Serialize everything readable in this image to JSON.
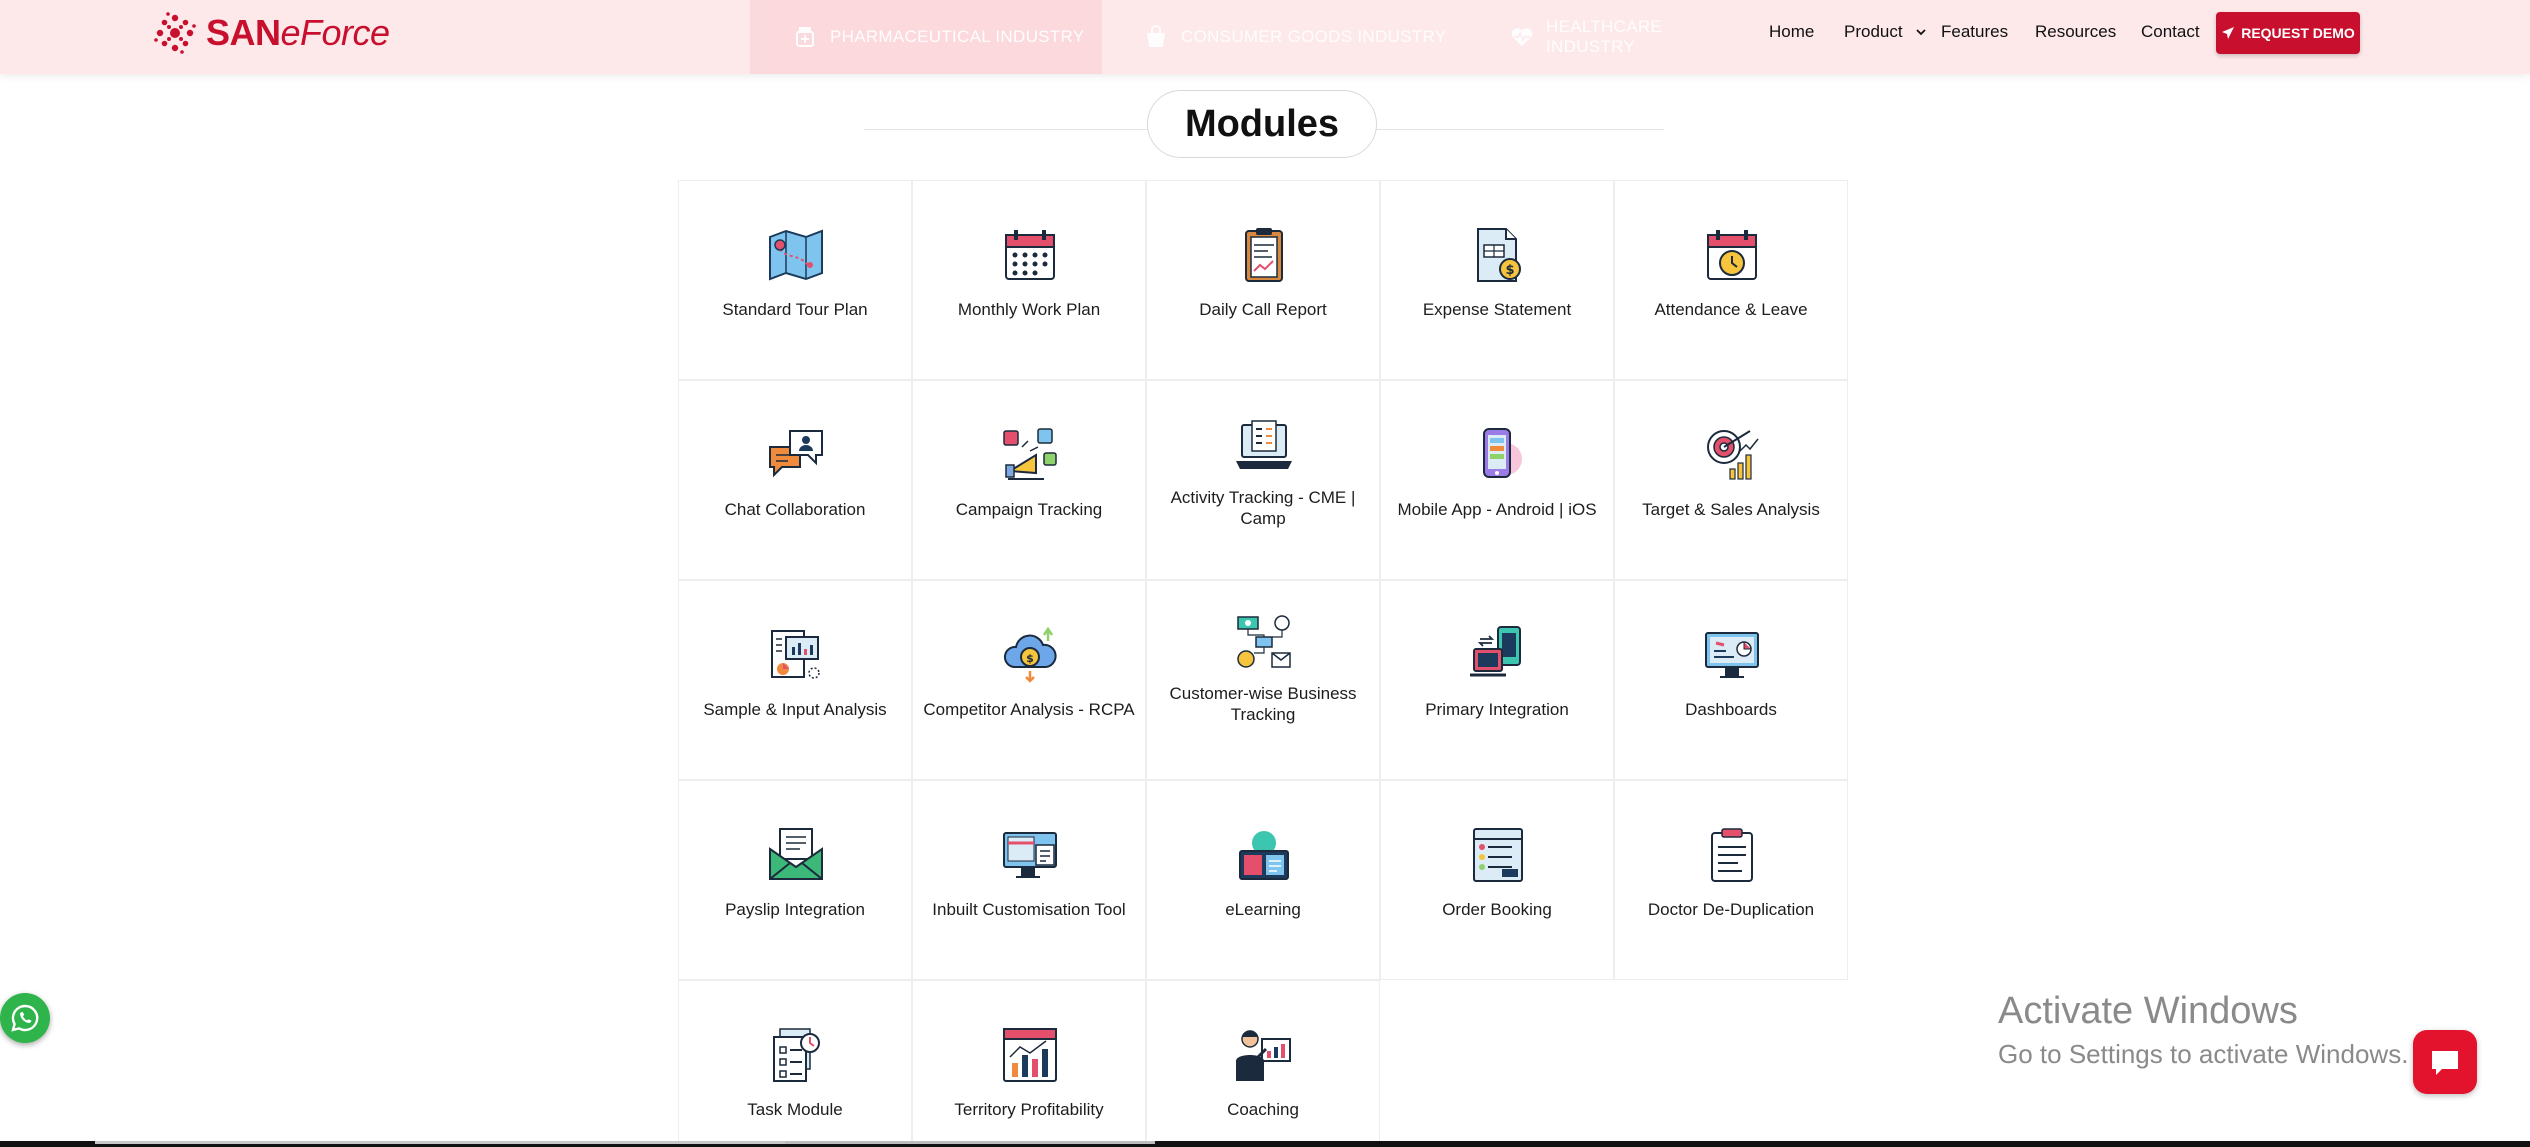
{
  "header": {
    "logo": {
      "brand_a": "SAN",
      "brand_b": "eForce"
    },
    "industry_tabs": [
      {
        "label": "PHARMACEUTICAL INDUSTRY",
        "icon": "pill-bottle-icon"
      },
      {
        "label": "CONSUMER GOODS INDUSTRY",
        "icon": "shopping-bag-icon"
      },
      {
        "label": "HEALTHCARE INDUSTRY",
        "icon": "heart-pulse-icon"
      }
    ],
    "nav": {
      "home": "Home",
      "product": "Product",
      "features": "Features",
      "resources": "Resources",
      "contact": "Contact"
    },
    "request_demo": "REQUEST DEMO"
  },
  "section": {
    "title": "Modules"
  },
  "modules": [
    {
      "label": "Standard Tour Plan",
      "icon": "map-route-icon"
    },
    {
      "label": "Monthly Work Plan",
      "icon": "calendar-grid-icon"
    },
    {
      "label": "Daily Call Report",
      "icon": "clipboard-report-icon"
    },
    {
      "label": "Expense Statement",
      "icon": "expense-document-icon"
    },
    {
      "label": "Attendance & Leave",
      "icon": "calendar-clock-icon"
    },
    {
      "label": "Chat Collaboration",
      "icon": "chat-bubbles-icon"
    },
    {
      "label": "Campaign Tracking",
      "icon": "campaign-megaphone-icon"
    },
    {
      "label": "Activity Tracking - CME | Camp",
      "icon": "laptop-checklist-icon"
    },
    {
      "label": "Mobile App - Android | iOS",
      "icon": "mobile-app-icon"
    },
    {
      "label": "Target & Sales Analysis",
      "icon": "target-chart-icon"
    },
    {
      "label": "Sample & Input Analysis",
      "icon": "document-chart-icon"
    },
    {
      "label": "Competitor Analysis - RCPA",
      "icon": "cloud-coin-icon"
    },
    {
      "label": "Customer-wise Business Tracking",
      "icon": "business-flow-icon"
    },
    {
      "label": "Primary Integration",
      "icon": "devices-sync-icon"
    },
    {
      "label": "Dashboards",
      "icon": "monitor-dashboard-icon"
    },
    {
      "label": "Payslip Integration",
      "icon": "envelope-payslip-icon"
    },
    {
      "label": "Inbuilt Customisation Tool",
      "icon": "desktop-tools-icon"
    },
    {
      "label": "eLearning",
      "icon": "elearning-book-icon"
    },
    {
      "label": "Order Booking",
      "icon": "order-list-icon"
    },
    {
      "label": "Doctor De-Duplication",
      "icon": "clipboard-doctor-icon"
    },
    {
      "label": "Task Module",
      "icon": "task-documents-icon"
    },
    {
      "label": "Territory Profitability",
      "icon": "territory-chart-icon"
    },
    {
      "label": "Coaching",
      "icon": "coach-presentation-icon"
    }
  ],
  "windows_watermark": {
    "line1": "Activate Windows",
    "line2": "Go to Settings to activate Windows."
  },
  "colors": {
    "brand_red": "#c8102e",
    "header_bg": "#fde8ea",
    "whatsapp": "#2eb44a",
    "chat": "#e3122d"
  }
}
